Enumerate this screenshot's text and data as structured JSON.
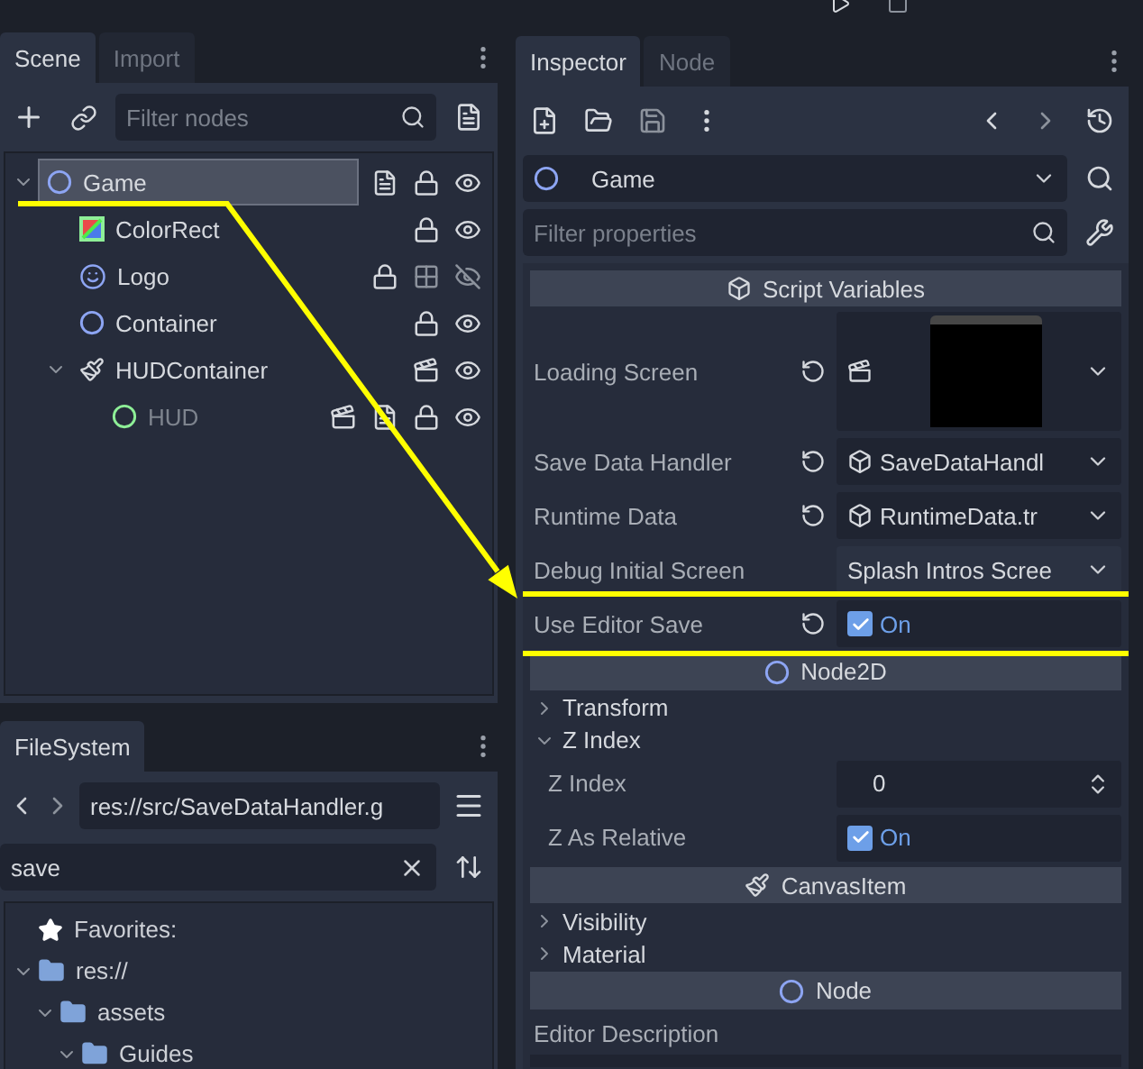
{
  "scene_dock": {
    "tabs": [
      {
        "label": "Scene",
        "selected": true
      },
      {
        "label": "Import",
        "selected": false
      }
    ],
    "filter": {
      "placeholder": "Filter nodes"
    },
    "tree": [
      {
        "name": "Game",
        "kind": "node",
        "selected": true,
        "dimmed": false,
        "expanded": true,
        "instanced": false,
        "has_script": true,
        "grouped": false,
        "locked": true,
        "visible": true,
        "children": [
          {
            "name": "ColorRect",
            "kind": "colorrect",
            "selected": false,
            "dimmed": false,
            "instanced": false,
            "has_script": false,
            "grouped": false,
            "locked": true,
            "visible": true
          },
          {
            "name": "Logo",
            "kind": "sprite",
            "selected": false,
            "dimmed": false,
            "instanced": false,
            "has_script": false,
            "grouped": true,
            "locked": true,
            "visible": false
          },
          {
            "name": "Container",
            "kind": "node",
            "selected": false,
            "dimmed": false,
            "instanced": false,
            "has_script": false,
            "grouped": false,
            "locked": true,
            "visible": true
          },
          {
            "name": "HUDContainer",
            "kind": "canvas",
            "selected": false,
            "dimmed": false,
            "expanded": true,
            "instanced": true,
            "has_script": false,
            "grouped": false,
            "locked": false,
            "visible": true,
            "children": [
              {
                "name": "HUD",
                "kind": "control",
                "selected": false,
                "dimmed": true,
                "instanced": true,
                "has_script": true,
                "grouped": false,
                "locked": true,
                "visible": true
              }
            ]
          }
        ]
      }
    ]
  },
  "filesystem_dock": {
    "tabs": [
      {
        "label": "FileSystem",
        "selected": true
      }
    ],
    "path": "res://src/SaveDataHandler.g",
    "search": {
      "value": "save"
    },
    "tree": [
      {
        "name": "Favorites:",
        "kind": "favorites"
      },
      {
        "name": "res://",
        "kind": "folder",
        "expanded": true,
        "children": [
          {
            "name": "assets",
            "kind": "folder",
            "expanded": true,
            "children": [
              {
                "name": "Guides",
                "kind": "folder",
                "expanded": true
              }
            ]
          }
        ]
      }
    ]
  },
  "inspector": {
    "tabs": [
      {
        "label": "Inspector",
        "selected": true
      },
      {
        "label": "Node",
        "selected": false
      }
    ],
    "object": {
      "name": "Game"
    },
    "filter": {
      "placeholder": "Filter properties"
    },
    "items": [
      {
        "kind": "script",
        "label": "Script Variables"
      },
      {
        "kind": "texture",
        "label": "Loading Screen",
        "revertable": true,
        "highlighted": false
      },
      {
        "kind": "resource",
        "label": "Save Data Handler",
        "value": "SaveDataHandl",
        "revertable": true,
        "highlighted": false
      },
      {
        "kind": "resource",
        "label": "Runtime Data",
        "value": "RuntimeData.tr",
        "revertable": true,
        "highlighted": false
      },
      {
        "kind": "enum",
        "label": "Debug Initial Screen",
        "value": "Splash Intros Scree",
        "revertable": false,
        "highlighted": false
      },
      {
        "kind": "checkbox",
        "label": "Use Editor Save",
        "checked": true,
        "value": "On",
        "revertable": true,
        "highlighted": true
      },
      {
        "kind": "node",
        "label": "Node2D"
      },
      {
        "kind": "group",
        "label": "Transform",
        "expanded": false
      },
      {
        "kind": "group",
        "label": "Z Index",
        "expanded": true,
        "children": [
          {
            "kind": "spin",
            "label": "Z Index",
            "value": "0"
          },
          {
            "kind": "checkbox",
            "label": "Z As Relative",
            "checked": true,
            "value": "On"
          }
        ]
      },
      {
        "kind": "canvas",
        "label": "CanvasItem"
      },
      {
        "kind": "group",
        "label": "Visibility",
        "expanded": false
      },
      {
        "kind": "group",
        "label": "Material",
        "expanded": false
      },
      {
        "kind": "node",
        "label": "Node"
      },
      {
        "kind": "textarea",
        "label": "Editor Description"
      }
    ]
  }
}
